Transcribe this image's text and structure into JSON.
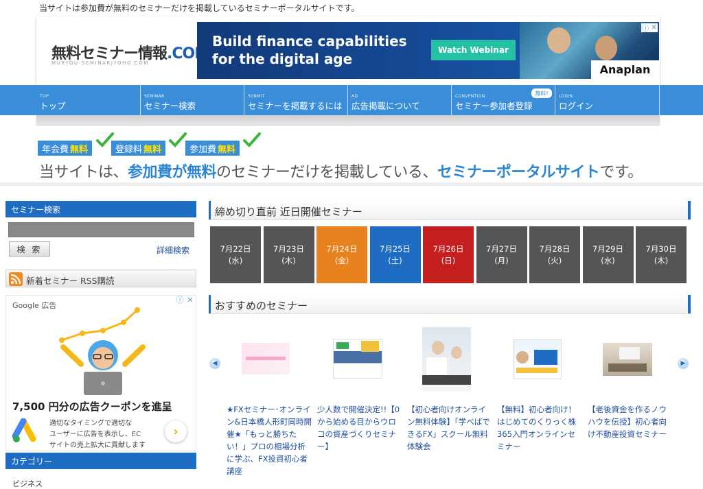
{
  "top_description": "当サイトは参加費が無料のセミナーだけを掲載しているセミナーポータルサイトです。",
  "logo": {
    "main": "無料セミナー情報",
    "com": ".COM",
    "sub": "MURYOU-SEMINARJYOHO.COM"
  },
  "banner": {
    "line1": "Build finance capabilities",
    "line2": "for the digital age",
    "cta": "Watch Webinar",
    "brand": "Anaplan"
  },
  "nav": [
    {
      "en": "TOP",
      "ja": "トップ"
    },
    {
      "en": "SEMINAR",
      "ja": "セミナー検索"
    },
    {
      "en": "SUBMIT",
      "ja": "セミナーを掲載するには"
    },
    {
      "en": "AD",
      "ja": "広告掲載について"
    },
    {
      "en": "CONVENTION",
      "ja": "セミナー参加者登録"
    },
    {
      "en": "LOGIN",
      "ja": "ログイン"
    }
  ],
  "nav_free_badge": "無料!",
  "badges": [
    {
      "label": "年会費",
      "free": "無料"
    },
    {
      "label": "登録料",
      "free": "無料"
    },
    {
      "label": "参加費",
      "free": "無料"
    }
  ],
  "tagline": {
    "p1": "当サイトは、",
    "p2": "参加費が無料",
    "p3": "のセミナーだけを掲載している、",
    "p4": "セミナーポータルサイト",
    "p5": "です。"
  },
  "sidebar": {
    "search_title": "セミナー検索",
    "search_button": "検 索",
    "detail_link": "詳細検索",
    "rss_label": "新着セミナー RSS購読",
    "ad": {
      "label": "Google 広告",
      "headline": "7,500 円分の広告クーポンを進呈",
      "line1": "適切なタイミングで適切な",
      "line2": "ユーザーに広告を表示し、EC",
      "line3": "サイトの売上拡大に貢献します"
    },
    "category_title": "カテゴリー",
    "category_first": "ビジネス"
  },
  "deadline": {
    "title": "締め切り直前 近日開催セミナー",
    "days": [
      {
        "date": "7月22日",
        "dow": "(水)",
        "color": "#555555"
      },
      {
        "date": "7月23日",
        "dow": "(木)",
        "color": "#555555"
      },
      {
        "date": "7月24日",
        "dow": "(金)",
        "color": "#e8821f"
      },
      {
        "date": "7月25日",
        "dow": "(土)",
        "color": "#1f6dc2"
      },
      {
        "date": "7月26日",
        "dow": "(日)",
        "color": "#c41e1e"
      },
      {
        "date": "7月27日",
        "dow": "(月)",
        "color": "#555555"
      },
      {
        "date": "7月28日",
        "dow": "(火)",
        "color": "#555555"
      },
      {
        "date": "7月29日",
        "dow": "(水)",
        "color": "#555555"
      },
      {
        "date": "7月30日",
        "dow": "(木)",
        "color": "#555555"
      }
    ]
  },
  "recommended": {
    "title": "おすすめのセミナー",
    "cards": [
      {
        "title": "★FXセミナー･オンライン&日本橋人形町同時開催★「もっと勝ちたい！」プロの相場分析に学ぶ、FX投資初心者講座"
      },
      {
        "title": "少人数で開催決定!!【0から始める目からウロコの資産づくりセミナー】"
      },
      {
        "title": "【初心者向けオンライン無料体験】「学べばできるFX」スクール無料体験会"
      },
      {
        "title": "【無料】初心者向け！はじめてのくりっく株365入門オンラインセミナー"
      },
      {
        "title": "【老後資金を作るノウハウを伝授】初心者向け不動産投資セミナー"
      }
    ]
  }
}
